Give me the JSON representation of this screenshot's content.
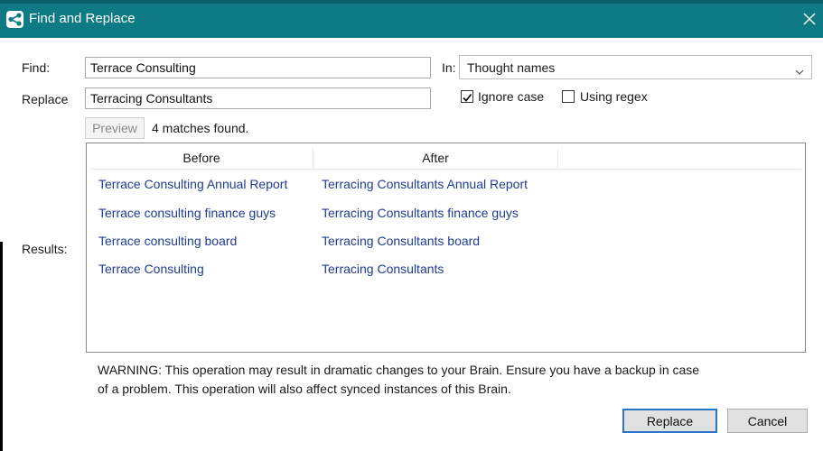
{
  "window": {
    "title": "Find and Replace",
    "icon": "brain-app-icon",
    "accent": "#0d7a85"
  },
  "form": {
    "find_label": "Find:",
    "find_value": "Terrace Consulting",
    "replace_label": "Replace",
    "replace_value": "Terracing Consultants",
    "in_label": "In:",
    "in_value": "Thought names",
    "ignore_case_label": "Ignore case",
    "ignore_case_checked": true,
    "regex_label": "Using regex",
    "regex_checked": false,
    "preview_label": "Preview",
    "matches_text": "4 matches found.",
    "results_label": "Results:"
  },
  "results": {
    "columns": [
      "Before",
      "After"
    ],
    "rows": [
      {
        "before": "Terrace Consulting Annual Report",
        "after": "Terracing Consultants Annual Report"
      },
      {
        "before": "Terrace consulting finance guys",
        "after": "Terracing Consultants finance guys"
      },
      {
        "before": "Terrace consulting board",
        "after": "Terracing Consultants board"
      },
      {
        "before": "Terrace Consulting",
        "after": "Terracing Consultants"
      }
    ]
  },
  "warning": {
    "line1": "WARNING: This operation may result in dramatic changes to your Brain. Ensure you have a backup in case",
    "line2": "of a problem. This operation will also affect synced instances of this Brain."
  },
  "buttons": {
    "replace": "Replace",
    "cancel": "Cancel"
  }
}
